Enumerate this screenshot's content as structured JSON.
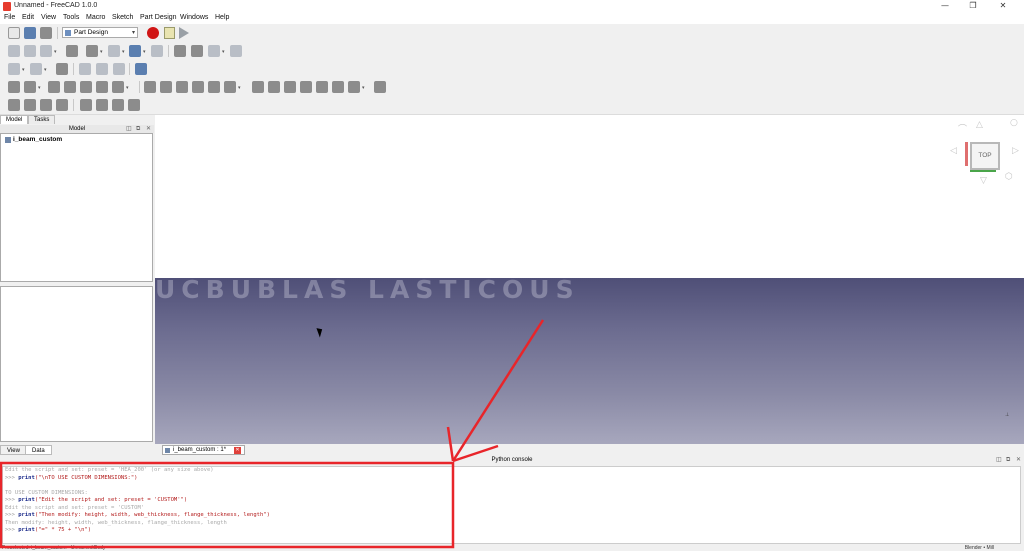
{
  "window": {
    "title": "Unnamed - FreeCAD 1.0.0",
    "minimize": "—",
    "maximize": "❐",
    "close": "✕"
  },
  "menu": [
    "File",
    "Edit",
    "View",
    "Tools",
    "Macro",
    "Sketch",
    "Part Design",
    "Windows",
    "Help"
  ],
  "toolbar": {
    "workbench": "Part Design"
  },
  "left_panel": {
    "tabs": [
      "Model",
      "Tasks"
    ],
    "header": "Model",
    "tree_item": "i_beam_custom",
    "bottom_tabs": [
      "View",
      "Data"
    ]
  },
  "viewport": {
    "background_text": "UCBUBLAS LASTICOUS",
    "navcube_face": "TOP",
    "top_color": "#ffffff",
    "gradient_top": "#4f4f77",
    "gradient_bottom": "#a7a7bd"
  },
  "document_tab": {
    "label": "i_beam_custom : 1*"
  },
  "console": {
    "title": "Python console",
    "lines": [
      {
        "kind": "out",
        "text": "Edit the script and set: preset = 'HEA_200' (or any size above)"
      },
      {
        "kind": "cmd",
        "prompt": ">>> ",
        "func": "print",
        "args": "(\"\\nTO USE CUSTOM DIMENSIONS:\")"
      },
      {
        "kind": "blank",
        "text": ""
      },
      {
        "kind": "out",
        "text": "TO USE CUSTOM DIMENSIONS:"
      },
      {
        "kind": "cmd",
        "prompt": ">>> ",
        "func": "print",
        "args": "(\"Edit the script and set: preset = 'CUSTOM'\")"
      },
      {
        "kind": "out",
        "text": "Edit the script and set: preset = 'CUSTOM'"
      },
      {
        "kind": "cmd",
        "prompt": ">>> ",
        "func": "print",
        "args": "(\"Then modify: height, width, web_thickness, flange_thickness, length\")"
      },
      {
        "kind": "out",
        "text": "Then modify: height, width, web_thickness, flange_thickness, length"
      },
      {
        "kind": "cmd",
        "prompt": ">>> ",
        "func": "print",
        "args": "(\"=\" * 75 + \"\\n\")"
      }
    ]
  },
  "statusbar": {
    "left": "Preselected: i_beam_custom - Unnamed.Body",
    "right": "Blender • Mill"
  },
  "annotation": {
    "color": "#e8252a"
  }
}
